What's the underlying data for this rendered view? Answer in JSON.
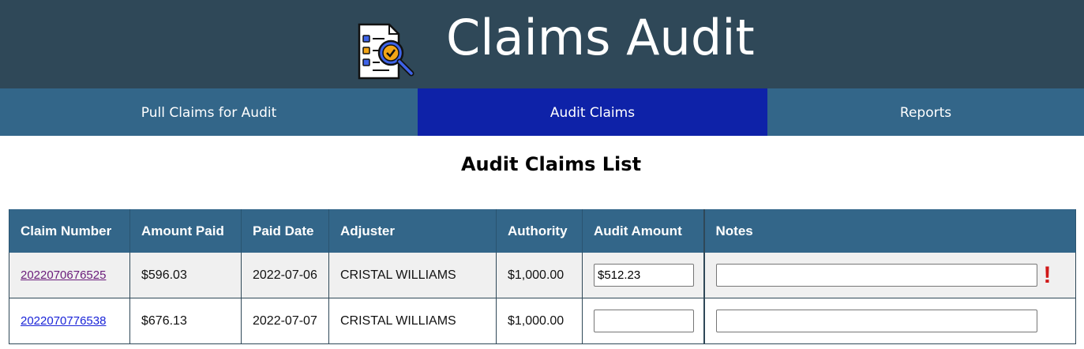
{
  "app": {
    "title": "Claims Audit",
    "logo_icon": "audit-document-magnifier-icon"
  },
  "nav": {
    "tabs": [
      {
        "label": "Pull Claims for Audit",
        "active": false
      },
      {
        "label": "Audit Claims",
        "active": true
      },
      {
        "label": "Reports",
        "active": false
      }
    ]
  },
  "page": {
    "title": "Audit Claims List"
  },
  "table": {
    "headers": [
      "Claim Number",
      "Amount Paid",
      "Paid Date",
      "Adjuster",
      "Authority",
      "Audit Amount",
      "Notes"
    ],
    "rows": [
      {
        "claim_number": "2022070676525",
        "amount_paid": "$596.03",
        "paid_date": "2022-07-06",
        "adjuster": "CRISTAL WILLIAMS",
        "authority": "$1,000.00",
        "audit_amount": "$512.23",
        "notes": "",
        "flag": "!",
        "flag_icon": "exclamation-alert-icon"
      },
      {
        "claim_number": "2022070776538",
        "amount_paid": "$676.13",
        "paid_date": "2022-07-07",
        "adjuster": "CRISTAL WILLIAMS",
        "authority": "$1,000.00",
        "audit_amount": "",
        "notes": ""
      }
    ]
  },
  "colors": {
    "header_bg": "#2f4858",
    "nav_bg": "#336689",
    "nav_active_bg": "#0e22a8",
    "alert": "#d01818",
    "visited_link": "#6a1b7a",
    "link": "#1a24d8"
  }
}
